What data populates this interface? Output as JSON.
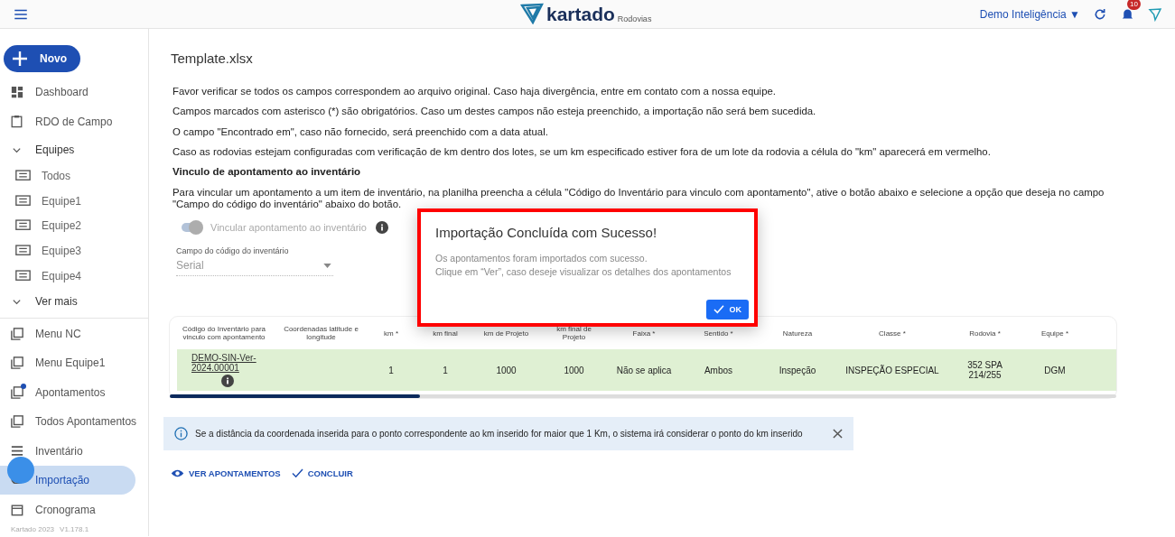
{
  "header": {
    "logo": "kartado",
    "logo_sub": "Rodovias",
    "company": "Demo Inteligência ▼",
    "notifications": "10"
  },
  "sidebar": {
    "new_button": "Novo",
    "items": [
      {
        "kind": "item",
        "label": "Dashboard",
        "selected": false
      },
      {
        "kind": "item",
        "label": "RDO de Campo",
        "selected": false
      },
      {
        "kind": "group",
        "label": "Equipes",
        "expanded": true,
        "children": [
          {
            "label": "Todos"
          },
          {
            "label": "Equipe1"
          },
          {
            "label": "Equipe2"
          },
          {
            "label": "Equipe3"
          },
          {
            "label": "Equipe4"
          }
        ]
      },
      {
        "kind": "group",
        "label": "Ver mais"
      },
      {
        "kind": "item",
        "label": "Menu NC",
        "selected": false
      },
      {
        "kind": "item",
        "label": "Menu Equipe1",
        "selected": false
      },
      {
        "kind": "item",
        "label": "Apontamentos",
        "selected": false,
        "dot": true
      },
      {
        "kind": "item",
        "label": "Todos Apontamentos",
        "selected": false
      },
      {
        "kind": "item",
        "label": "Inventário",
        "selected": false
      },
      {
        "kind": "item",
        "label": "Importação",
        "selected": true
      },
      {
        "kind": "item",
        "label": "Cronograma",
        "selected": false
      }
    ],
    "footer": [
      "Kartado 2023",
      "V1.178.1"
    ]
  },
  "page": {
    "title": "Template.xlsx",
    "paragraphs": [
      "Favor verificar se todos os campos correspondem ao arquivo original. Caso haja divergência, entre em contato com a nossa equipe.",
      "Campos marcados com asterisco (*) são obrigatórios. Caso um destes campos não esteja preenchido, a importação não será bem sucedida.",
      "O campo \"Encontrado em\", caso não fornecido, será preenchido com a data atual.",
      "Caso as rodovias estejam configuradas com verificação de km dentro dos lotes, se um km especificado estiver fora de um lote da rodovia a célula do \"km\" aparecerá em vermelho."
    ],
    "section_title": "Vinculo de apontamento ao inventário",
    "section_text": "Para vincular um apontamento a um item de inventário, na planilha preencha a célula \"Código do Inventário para vinculo com apontamento\", ative o botão abaixo e selecione a opção que deseja no campo \"Campo do código do inventário\" abaixo do botão.",
    "toggle": {
      "label": "Vincular apontamento ao inventário",
      "on": true,
      "disabled": true
    },
    "select": {
      "label": "Campo do código do inventário",
      "value": "Serial"
    },
    "table": {
      "columns": [
        "Código do Inventário para vinculo com apontamento",
        "Coordenadas latitude e longitude",
        "km *",
        "km final",
        "km de Projeto",
        "km final de Projeto",
        "Faixa *",
        "Sentido *",
        "Natureza",
        "Classe *",
        "Rodovia *",
        "Equipe *"
      ],
      "rows": [
        {
          "cells": [
            "DEMO-SIN-Ver-2024.00001",
            "",
            "1",
            "1",
            "1000",
            "1000",
            "Não se aplica",
            "Ambos",
            "Inspeção",
            "INSPEÇÃO ESPECIAL",
            "352 SPA 214/255",
            "DGM"
          ]
        }
      ]
    },
    "alert": "Se a distância da coordenada inserida para o ponto correspondente ao km inserido for maior que 1 Km, o sistema irá considerar o ponto do km inserido",
    "actions": [
      "VER APONTAMENTOS",
      "CONCLUIR"
    ]
  },
  "dialog": {
    "title": "Importação Concluída com Sucesso!",
    "lines": [
      "Os apontamentos foram importados com sucesso.",
      "Clique em “Ver”, caso deseje visualizar os detalhes dos apontamentos"
    ],
    "button": "OK"
  }
}
